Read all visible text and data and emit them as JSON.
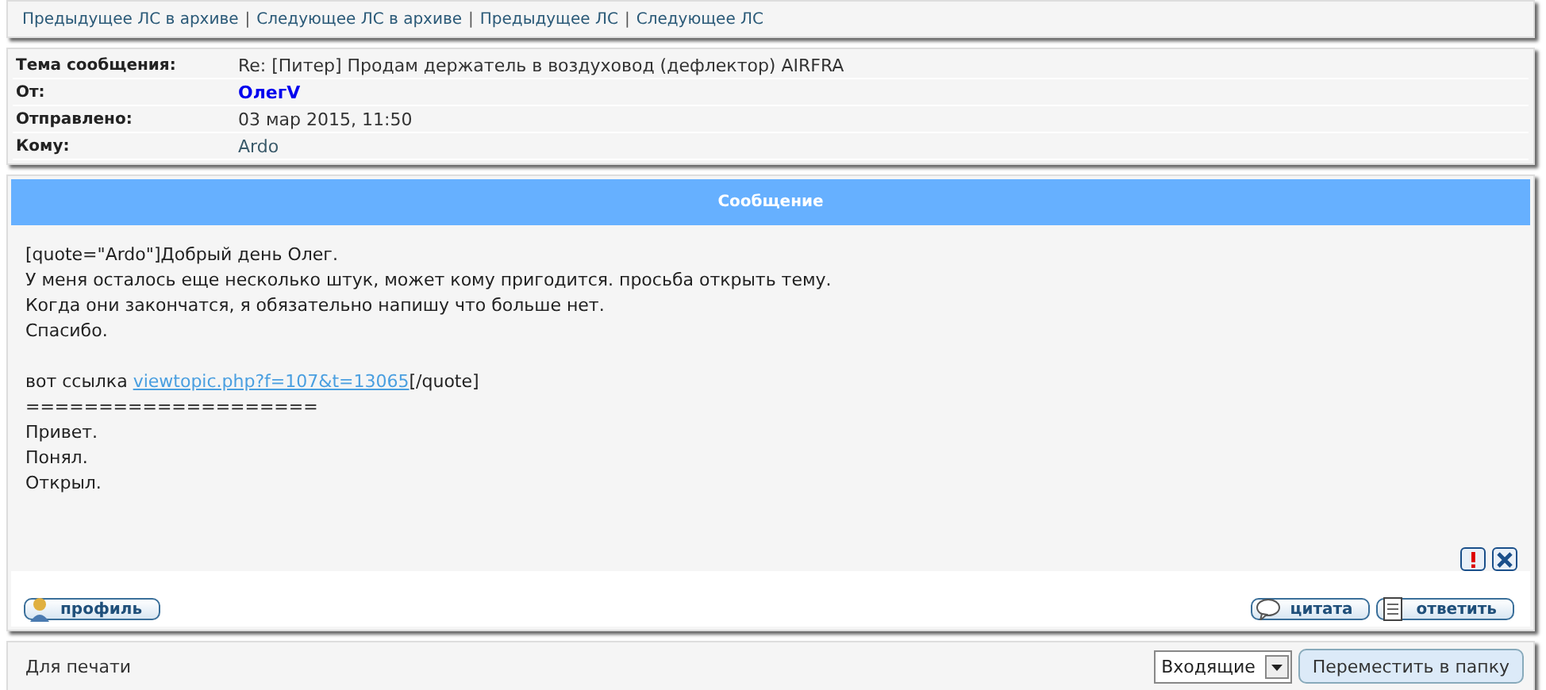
{
  "nav_links": [
    "Предыдущее ЛС в архиве",
    "Следующее ЛС в архиве",
    "Предыдущее ЛС",
    "Следующее ЛС"
  ],
  "nav_separator": "|",
  "header": [
    {
      "label": "Тема сообщения:",
      "value": "Re: [Питер] Продам держатель в воздуховод (дефлектор) AIRFRA",
      "kind": "text"
    },
    {
      "label": "От:",
      "value": "ОлегV",
      "kind": "author"
    },
    {
      "label": "Отправлено:",
      "value": "03 мар 2015, 11:50",
      "kind": "text"
    },
    {
      "label": "Кому:",
      "value": "Ardo",
      "kind": "text"
    }
  ],
  "message": {
    "title": "Сообщение",
    "paragraphs": [
      [
        {
          "kind": "text",
          "text": "[quote=\"Ardo\"]Добрый день Олег."
        },
        {
          "kind": "text",
          "text": "У меня осталось еще несколько штук, может кому пригодится. просьба открыть тему."
        },
        {
          "kind": "text",
          "text": "Когда они закончатся, я обязательно напишу что больше нет."
        },
        {
          "kind": "text",
          "text": "Спасибо."
        }
      ],
      [
        {
          "kind": "link",
          "before": "вот ссылка",
          "link": "viewtopic.php?f=107&t=13065",
          "after": "[/quote]"
        },
        {
          "kind": "text",
          "text": "===================="
        },
        {
          "kind": "text",
          "text": "Привет."
        },
        {
          "kind": "text",
          "text": "Понял."
        },
        {
          "kind": "text",
          "text": "Открыл."
        }
      ]
    ],
    "profile_button": "профиль",
    "quote_button": "цитата",
    "reply_button": "ответить"
  },
  "footer": {
    "print_link": "Для печати",
    "folder_select": "Входящие",
    "move_button": "Переместить в папку"
  }
}
